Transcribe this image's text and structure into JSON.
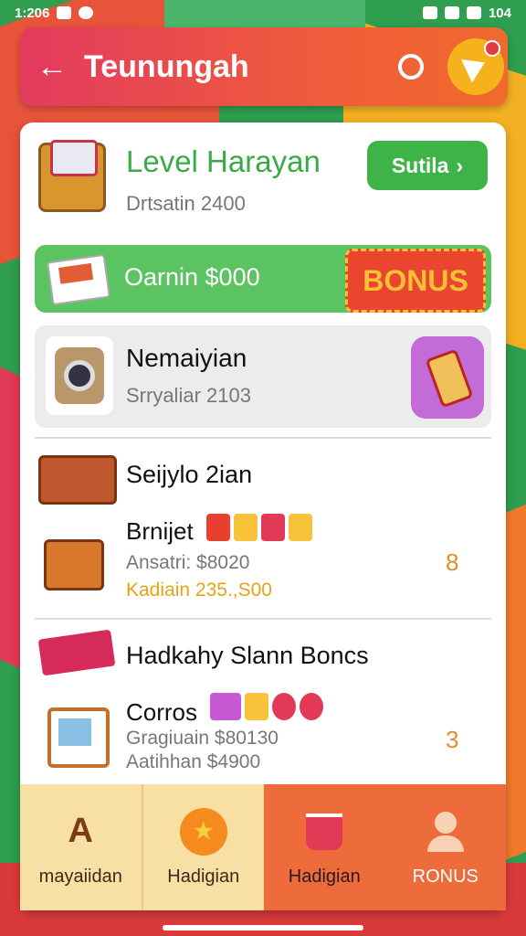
{
  "status": {
    "time": "1:206",
    "battery": "104"
  },
  "appbar": {
    "back": "←",
    "title": "Teunungah"
  },
  "level": {
    "title": "Level Harayan",
    "subtitle": "Drtsatin 2400",
    "button_label": "Sutila",
    "button_arrow": "›"
  },
  "promo_bar": {
    "text": "Oarnin $000",
    "badge": "BONUS"
  },
  "featured": {
    "title": "Nemaiyian",
    "subtitle": "Srryaliar 2103"
  },
  "section1": {
    "title": "Seijylo 2ian",
    "row": {
      "title": "Brnijet",
      "line1": "Ansatri: $8020",
      "line2": "Kadiain 235.,S00",
      "count": "8"
    }
  },
  "section2": {
    "title": "Hadkahy Slann Boncs",
    "row": {
      "title": "Corros",
      "line1": "Gragiuain $80130",
      "line2": "Aatihhan $4900",
      "count": "3"
    }
  },
  "nav": [
    {
      "label": "mayaiidan",
      "icon": "home-icon"
    },
    {
      "label": "Hadigian",
      "icon": "coin-icon"
    },
    {
      "label": "Hadigian",
      "icon": "cup-icon"
    },
    {
      "label": "RONUS",
      "icon": "person-icon"
    }
  ],
  "colors": {
    "appbar": "#e33a5f",
    "accent_green": "#3db348",
    "bonus": "#e9452f",
    "nav_active": "#ee6b3b"
  }
}
